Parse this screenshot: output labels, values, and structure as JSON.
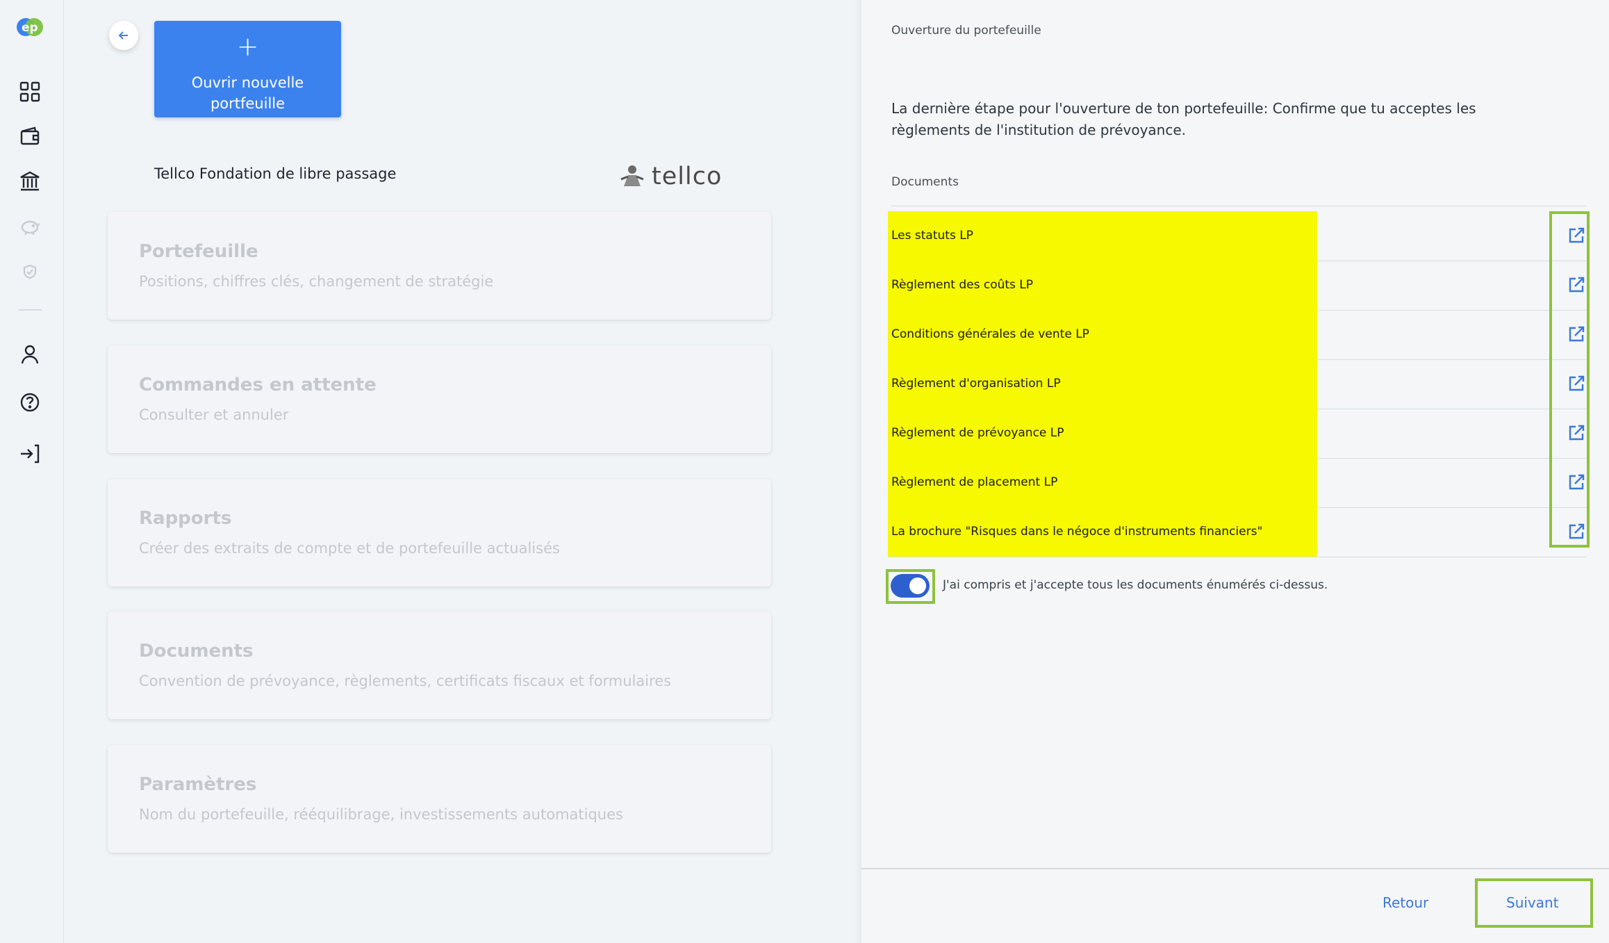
{
  "sidebar": {
    "logo": "ep",
    "items": [
      {
        "name": "dashboard-icon"
      },
      {
        "name": "wallet-icon"
      },
      {
        "name": "bank-icon"
      },
      {
        "name": "piggy-bank-icon"
      },
      {
        "name": "shield-icon"
      },
      {
        "name": "user-icon"
      },
      {
        "name": "help-icon"
      },
      {
        "name": "logout-icon"
      }
    ]
  },
  "left": {
    "new_portfolio_label": "Ouvrir nouvelle portfeuille",
    "foundation_name": "Tellco Fondation de libre passage",
    "provider_logo_text": "tellco",
    "cards": [
      {
        "title": "Portefeuille",
        "subtitle": "Positions, chiffres clés, changement de stratégie"
      },
      {
        "title": "Commandes en attente",
        "subtitle": "Consulter et annuler"
      },
      {
        "title": "Rapports",
        "subtitle": "Créer des extraits de compte et de portefeuille actualisés"
      },
      {
        "title": "Documents",
        "subtitle": "Convention de prévoyance, règlements, certificats fiscaux et formulaires"
      },
      {
        "title": "Paramètres",
        "subtitle": "Nom du portefeuille, rééquilibrage, investissements automatiques"
      }
    ]
  },
  "right": {
    "title": "Ouverture du portefeuille",
    "intro": "La dernière étape pour l'ouverture de ton portefeuille: Confirme que tu acceptes les règlements de l'institution de prévoyance.",
    "documents_header": "Documents",
    "documents": [
      "Les statuts LP",
      "Règlement des coûts LP",
      "Conditions générales de vente LP",
      "Règlement d'organisation LP",
      "Règlement de prévoyance LP",
      "Règlement de placement LP",
      "La brochure \"Risques dans le négoce d'instruments financiers\""
    ],
    "accept_label": "J'ai compris et j'accepte tous les documents énumérés ci-dessus.",
    "accept_checked": true,
    "back_label": "Retour",
    "next_label": "Suivant"
  },
  "colors": {
    "accent": "#3c82ef",
    "link": "#3b78d9",
    "highlight": "#f6f900",
    "annotation_frame": "#8fc23b",
    "toggle_on": "#2e5fce"
  }
}
